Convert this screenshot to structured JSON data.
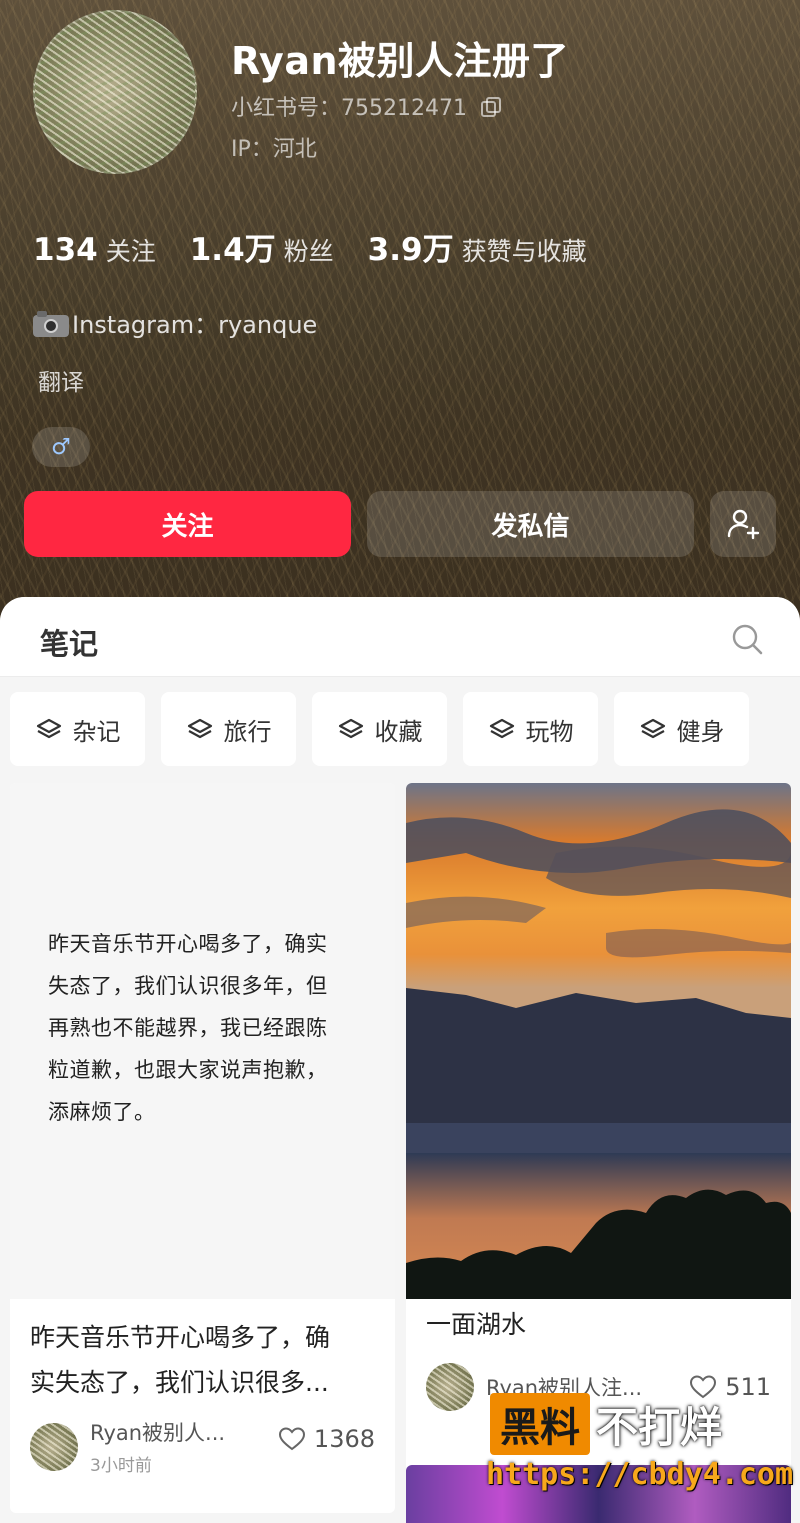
{
  "profile": {
    "name": "Ryan被别人注册了",
    "red_id": "小红书号：755212471",
    "ip": "IP：河北",
    "bio_icon": "camera-icon",
    "bio": "Instagram：ryanque",
    "translate": "翻译",
    "gender_symbol": "♂"
  },
  "stats": [
    {
      "num": "134",
      "label": "关注"
    },
    {
      "num": "1.4万",
      "label": "粉丝"
    },
    {
      "num": "3.9万",
      "label": "获赞与收藏"
    }
  ],
  "actions": {
    "follow": "关注",
    "message": "发私信",
    "add_friend_icon": "add-user-icon",
    "follow_color": "#ff2741"
  },
  "notes": {
    "tab": "笔记",
    "search_icon": "search-icon",
    "categories": [
      "杂记",
      "旅行",
      "收藏",
      "玩物",
      "健身"
    ]
  },
  "cards": {
    "left": {
      "cover_lines": [
        "昨天音乐节开心喝多了，确实",
        "失态了，我们认识很多年，但",
        "再熟也不能越界，我已经跟陈",
        "粒道歉，也跟大家说声抱歉，",
        "添麻烦了。"
      ],
      "title_lines": [
        "昨天音乐节开心喝多了，确",
        "实失态了，我们认识很多..."
      ],
      "author": "Ryan被别人...",
      "time": "3小时前",
      "likes": "1368"
    },
    "right": {
      "title": "一面湖水",
      "author": "Ryan被别人注...",
      "likes": "511"
    }
  },
  "watermark": {
    "badge": "黑料",
    "text": "不打烊",
    "url": "https://cbdy4.com"
  }
}
